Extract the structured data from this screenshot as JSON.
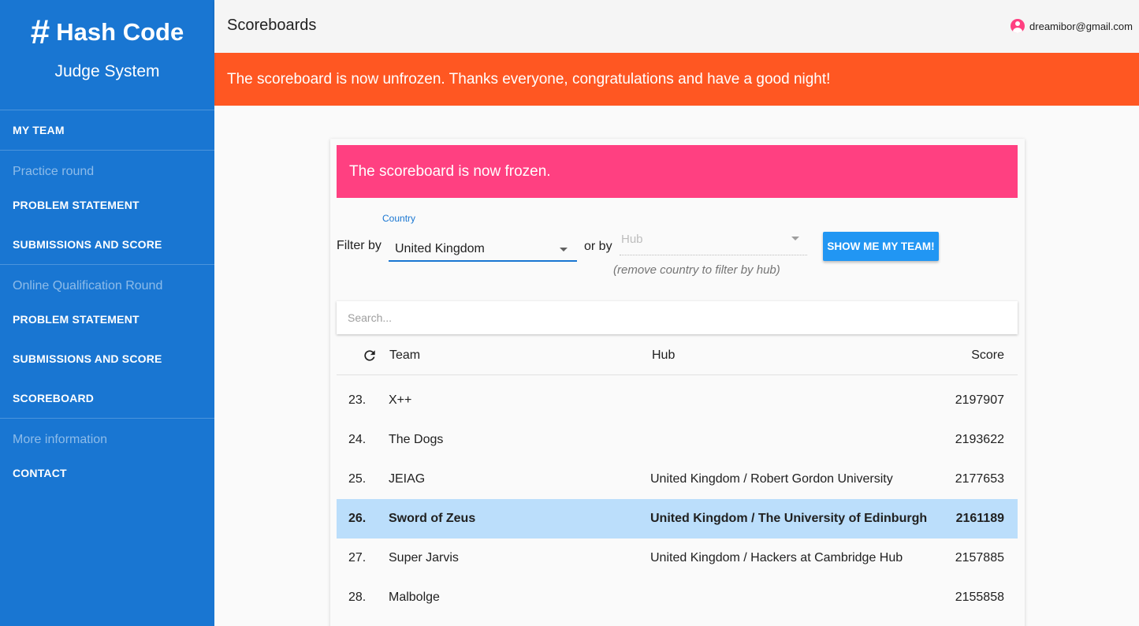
{
  "sidebar": {
    "brand_symbol": "#",
    "brand_title": "Hash Code",
    "brand_subtitle": "Judge System",
    "my_team": "MY TEAM",
    "sections": [
      {
        "heading": "Practice round",
        "items": [
          "PROBLEM STATEMENT",
          "SUBMISSIONS AND SCORE"
        ]
      },
      {
        "heading": "Online Qualification Round",
        "items": [
          "PROBLEM STATEMENT",
          "SUBMISSIONS AND SCORE",
          "SCOREBOARD"
        ]
      },
      {
        "heading": "More information",
        "items": [
          "CONTACT"
        ]
      }
    ]
  },
  "header": {
    "title": "Scoreboards",
    "user_email": "dreamibor@gmail.com"
  },
  "banner": {
    "text": "The scoreboard is now unfrozen. Thanks everyone, congratulations and have a good night!",
    "color": "#ff5722"
  },
  "scoreboard": {
    "frozen_notice": "The scoreboard is now frozen.",
    "frozen_color": "#ff4081",
    "filter_label": "Filter by",
    "country_label": "Country",
    "country_value": "United Kingdom",
    "or_by": "or by",
    "hub_placeholder": "Hub",
    "hub_hint": "(remove country to filter by hub)",
    "my_team_button": "SHOW ME MY TEAM!",
    "search_placeholder": "Search...",
    "columns": {
      "team": "Team",
      "hub": "Hub",
      "score": "Score"
    },
    "rows": [
      {
        "rank": "23.",
        "team": "X++",
        "hub": "",
        "score": "2197907",
        "highlight": false
      },
      {
        "rank": "24.",
        "team": "The Dogs",
        "hub": "",
        "score": "2193622",
        "highlight": false
      },
      {
        "rank": "25.",
        "team": "JEIAG",
        "hub": "United Kingdom / Robert Gordon University",
        "score": "2177653",
        "highlight": false
      },
      {
        "rank": "26.",
        "team": "Sword of Zeus",
        "hub": "United Kingdom / The University of Edinburgh",
        "score": "2161189",
        "highlight": true
      },
      {
        "rank": "27.",
        "team": "Super Jarvis",
        "hub": "United Kingdom / Hackers at Cambridge Hub",
        "score": "2157885",
        "highlight": false
      },
      {
        "rank": "28.",
        "team": "Malbolge",
        "hub": "",
        "score": "2155858",
        "highlight": false
      }
    ],
    "highlight_color": "#bbdefb"
  }
}
